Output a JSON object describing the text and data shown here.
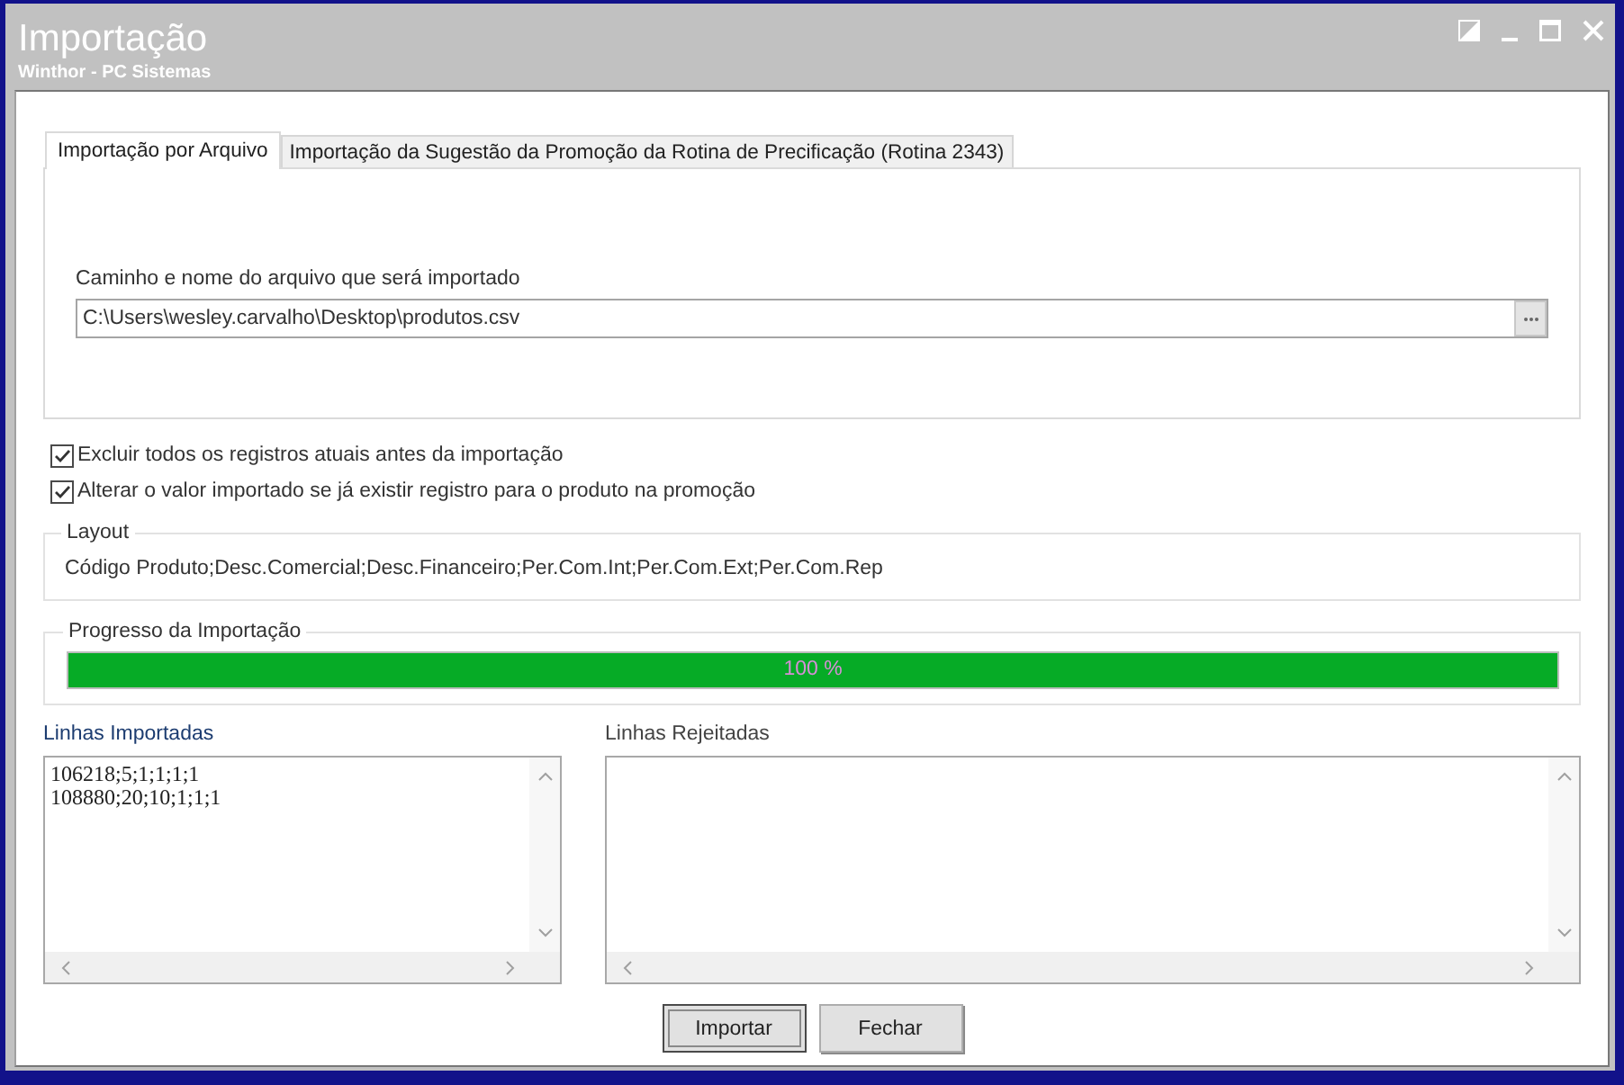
{
  "window": {
    "title": "Importação",
    "subtitle": "Winthor - PC Sistemas"
  },
  "tabs": [
    {
      "label": "Importação por Arquivo",
      "selected": true
    },
    {
      "label": "Importação da Sugestão da Promoção da Rotina de Precificação (Rotina 2343)",
      "selected": false
    }
  ],
  "file_path": {
    "label": "Caminho e nome do arquivo que será importado",
    "value": "C:\\Users\\wesley.carvalho\\Desktop\\produtos.csv"
  },
  "options": [
    {
      "label": "Excluir todos os registros atuais antes da importação",
      "checked": true
    },
    {
      "label": "Alterar o valor importado se já existir registro para o produto na promoção",
      "checked": true
    }
  ],
  "layout": {
    "title": "Layout",
    "value": "Código Produto;Desc.Comercial;Desc.Financeiro;Per.Com.Int;Per.Com.Ext;Per.Com.Rep"
  },
  "progress": {
    "title": "Progresso da Importação",
    "level": 1,
    "reading": "100 %"
  },
  "lists": [
    {
      "title": "Linhas Importadas",
      "focused": true,
      "lines": [
        "106218;5;1;1;1;1",
        "108880;20;10;1;1;1"
      ]
    },
    {
      "title": "Linhas Rejeitadas",
      "focused": false
    }
  ],
  "buttons": [
    {
      "label": "Importar",
      "default": true
    },
    {
      "label": "Fechar",
      "default": false
    }
  ]
}
